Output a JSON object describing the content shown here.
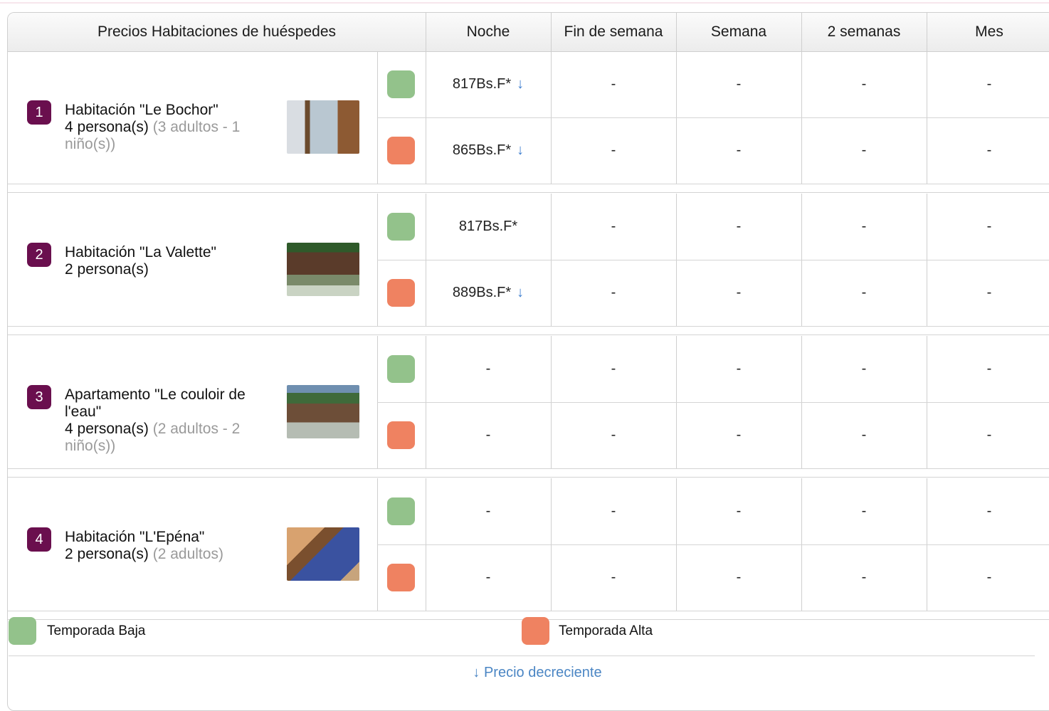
{
  "table": {
    "header": {
      "title": "Precios Habitaciones de huéspedes",
      "columns": [
        "Noche",
        "Fin de semana",
        "Semana",
        "2 semanas",
        "Mes"
      ]
    },
    "rooms": [
      {
        "number": "1",
        "name": "Habitación \"Le Bochor\"",
        "capacity": "4 persona(s)",
        "detail": " (3 adultos - 1 niño(s))",
        "seasons": [
          {
            "season": "low",
            "prices": [
              "817Bs.F*",
              "-",
              "-",
              "-",
              "-"
            ],
            "arrow": "↓"
          },
          {
            "season": "high",
            "prices": [
              "865Bs.F*",
              "-",
              "-",
              "-",
              "-"
            ],
            "arrow": "↓"
          }
        ]
      },
      {
        "number": "2",
        "name": "Habitación \"La Valette\"",
        "capacity": "2 persona(s)",
        "detail": "",
        "seasons": [
          {
            "season": "low",
            "prices": [
              "817Bs.F*",
              "-",
              "-",
              "-",
              "-"
            ],
            "arrow": ""
          },
          {
            "season": "high",
            "prices": [
              "889Bs.F*",
              "-",
              "-",
              "-",
              "-"
            ],
            "arrow": "↓"
          }
        ]
      },
      {
        "number": "3",
        "name": "Apartamento \"Le couloir de l'eau\"",
        "capacity": "4 persona(s)",
        "detail": " (2 adultos - 2 niño(s))",
        "seasons": [
          {
            "season": "low",
            "prices": [
              "-",
              "-",
              "-",
              "-",
              "-"
            ],
            "arrow": ""
          },
          {
            "season": "high",
            "prices": [
              "-",
              "-",
              "-",
              "-",
              "-"
            ],
            "arrow": ""
          }
        ]
      },
      {
        "number": "4",
        "name": "Habitación \"L'Epéna\"",
        "capacity": "2 persona(s)",
        "detail": " (2 adultos)",
        "seasons": [
          {
            "season": "low",
            "prices": [
              "-",
              "-",
              "-",
              "-",
              "-"
            ],
            "arrow": ""
          },
          {
            "season": "high",
            "prices": [
              "-",
              "-",
              "-",
              "-",
              "-"
            ],
            "arrow": ""
          }
        ]
      }
    ]
  },
  "legend": {
    "low_season": "Temporada Baja",
    "high_season": "Temporada Alta"
  },
  "footnote": "↓ Precio decreciente",
  "colors": {
    "low_season": "#93c28b",
    "high_season": "#ef8261",
    "badge": "#6a0f4e",
    "arrow": "#3f7fcf"
  }
}
